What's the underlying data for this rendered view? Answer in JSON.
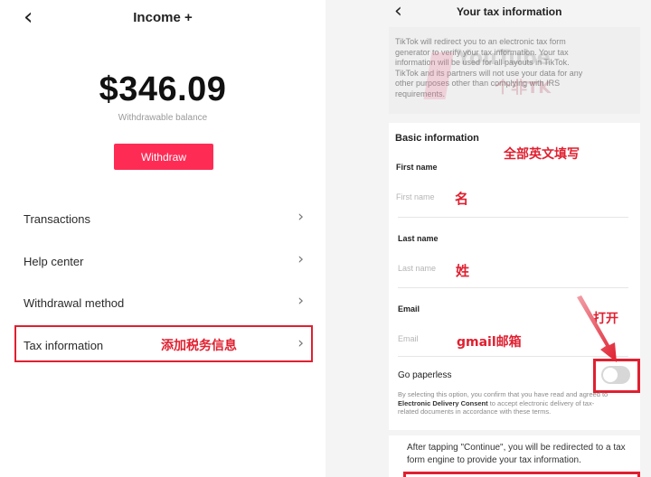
{
  "left": {
    "title": "Income +",
    "amount": "$346.09",
    "balance_label": "Withdrawable balance",
    "withdraw_label": "Withdraw",
    "menu": [
      {
        "label": "Transactions"
      },
      {
        "label": "Help center"
      },
      {
        "label": "Withdrawal method"
      },
      {
        "label": "Tax information"
      }
    ],
    "annotation": "添加税务信息",
    "highlight_color": "#e02030",
    "button_color": "#fe2c55"
  },
  "right": {
    "title": "Your tax information",
    "intro_lines": [
      "TikTok will redirect you to an electronic tax form",
      "generator to verify your tax information. Your tax",
      "information will be used for all payouts in TikTok.",
      "TikTok and its partners will not use your data for any",
      "other purposes other than complying with IRS",
      "requirements."
    ],
    "section_title": "Basic information",
    "section_note": "全部英文填写",
    "fields": [
      {
        "label": "First name",
        "placeholder": "First name",
        "note": "名"
      },
      {
        "label": "Last name",
        "placeholder": "Last name",
        "note": "姓"
      },
      {
        "label": "Email",
        "placeholder": "Email",
        "note": "gmail邮箱"
      }
    ],
    "paperless_label": "Go paperless",
    "toggle_note": "打开",
    "consent_before": "By selecting this option, you confirm that you have read and agreed to",
    "consent_link": "Electronic Delivery Consent",
    "consent_after": "to accept electronic delivery of tax-related documents in accordance with these terms.",
    "footer_note": "After tapping \"Continue\", you will be redirected to a tax form engine to provide your tax information.",
    "watermark_text_1": "YouTube",
    "watermark_text_2": "个非TK"
  }
}
